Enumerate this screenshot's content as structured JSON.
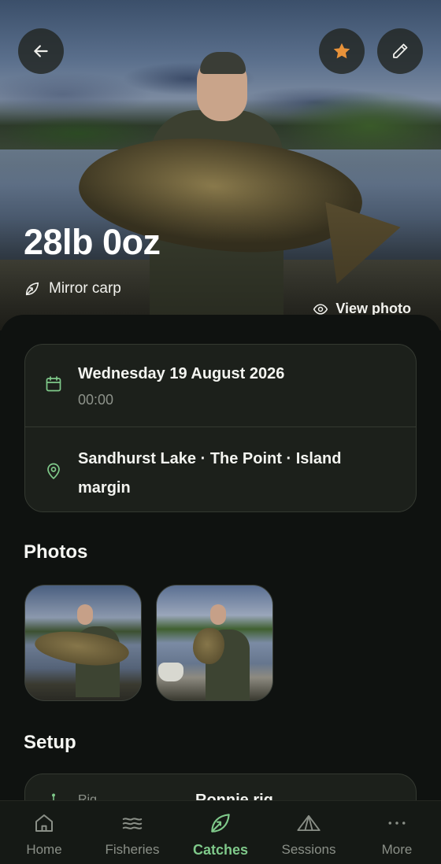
{
  "header": {
    "weight": "28lb 0oz",
    "species": "Mirror carp",
    "view_photo_label": "View photo"
  },
  "details": {
    "date": "Wednesday 19 August 2026",
    "time": "00:00",
    "location": "Sandhurst Lake · The Point · Island margin"
  },
  "sections": {
    "photos": "Photos",
    "setup": "Setup"
  },
  "setup": {
    "label": "Rig",
    "value": "Ronnie rig"
  },
  "nav": {
    "items": [
      {
        "label": "Home",
        "icon": "home-icon",
        "active": false
      },
      {
        "label": "Fisheries",
        "icon": "waves-icon",
        "active": false
      },
      {
        "label": "Catches",
        "icon": "leaf-icon",
        "active": true
      },
      {
        "label": "Sessions",
        "icon": "tent-icon",
        "active": false
      },
      {
        "label": "More",
        "icon": "more-dots-icon",
        "active": false
      }
    ]
  },
  "colors": {
    "accent": "#7fc98a",
    "favorite": "#e8923a",
    "background": "#0f1210",
    "card": "#1c201b"
  }
}
